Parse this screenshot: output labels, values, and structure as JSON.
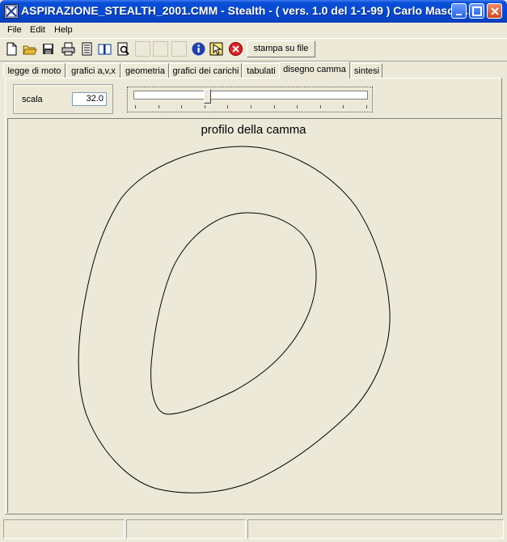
{
  "window": {
    "title": "ASPIRAZIONE_STEALTH_2001.CMM - Stealth -  ( vers. 1.0 del 1-1-99 ) Carlo Masott...",
    "controls": [
      "minimize-icon",
      "maximize-icon",
      "close-icon"
    ]
  },
  "menu": {
    "items": [
      "File",
      "Edit",
      "Help"
    ]
  },
  "toolbar": {
    "icons": [
      "new-file-icon",
      "open-folder-icon",
      "save-icon",
      "print-icon",
      "print-setup-icon",
      "book-icon",
      "print-preview-icon",
      "info-icon",
      "help-pointer-icon",
      "stop-icon"
    ],
    "stampa_label": "stampa su file"
  },
  "tabs": {
    "items": [
      "legge di moto",
      "grafici a,v,x",
      "geometria",
      "grafici dei carichi",
      "tabulati",
      "disegno camma",
      "sintesi"
    ],
    "active": "disegno camma"
  },
  "controls": {
    "scala_label": "scala",
    "scala_value": "32.0"
  },
  "drawing": {
    "title": "profilo della camma"
  }
}
